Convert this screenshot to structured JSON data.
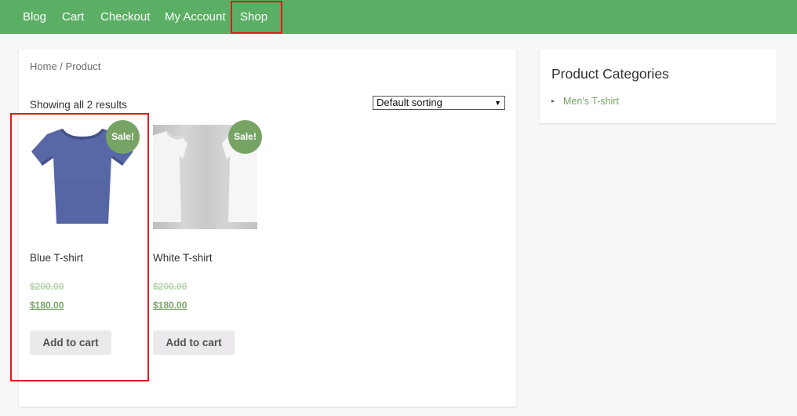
{
  "nav": {
    "items": [
      {
        "label": "Blog"
      },
      {
        "label": "Cart"
      },
      {
        "label": "Checkout"
      },
      {
        "label": "My Account"
      },
      {
        "label": "Shop"
      }
    ]
  },
  "breadcrumb": {
    "home": "Home",
    "separator": " / ",
    "current": "Product"
  },
  "shop": {
    "results_count": "Showing all 2 results",
    "sort_selected": "Default sorting",
    "products": [
      {
        "title": "Blue T-shirt",
        "badge": "Sale!",
        "regular_price": "$200.00",
        "sale_price": "$180.00",
        "button_label": "Add to cart"
      },
      {
        "title": "White T-shirt",
        "badge": "Sale!",
        "regular_price": "$200.00",
        "sale_price": "$180.00",
        "button_label": "Add to cart"
      }
    ]
  },
  "sidebar": {
    "widget_title": "Product Categories",
    "categories": [
      {
        "label": "Men's T-shirt"
      }
    ]
  },
  "colors": {
    "nav_background": "#5aaf64",
    "accent_green": "#77a464",
    "highlight_red": "#e01b1b"
  }
}
